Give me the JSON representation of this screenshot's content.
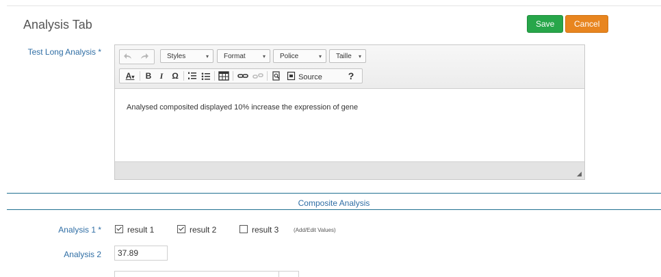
{
  "page": {
    "title": "Analysis Tab"
  },
  "actions": {
    "save_label": "Save",
    "cancel_label": "Cancel"
  },
  "fields": {
    "long_analysis": {
      "label": "Test Long Analysis *",
      "value": "Analysed composited displayed 10% increase the expression of gene"
    },
    "analysis_1": {
      "label": "Analysis 1 *",
      "options": [
        {
          "label": "result 1",
          "checked": true
        },
        {
          "label": "result 2",
          "checked": true
        },
        {
          "label": "result 3",
          "checked": false
        }
      ],
      "add_edit_link": "(Add/Edit Values)"
    },
    "analysis_2": {
      "label": "Analysis 2",
      "value": "37.89"
    }
  },
  "editor_toolbar": {
    "combos": {
      "styles": "Styles",
      "format": "Format",
      "police": "Police",
      "taille": "Taille"
    },
    "source_label": "Source",
    "icons": [
      "undo-icon",
      "redo-icon",
      "text-color-icon",
      "bold-icon",
      "italic-icon",
      "special-char-icon",
      "numbered-list-icon",
      "bulleted-list-icon",
      "table-icon",
      "link-icon",
      "unlink-icon",
      "preview-icon",
      "source-icon",
      "help-icon"
    ]
  },
  "section": {
    "title": "Composite Analysis"
  },
  "colors": {
    "label_blue": "#2e6da4",
    "save_green": "#27a64a",
    "cancel_orange": "#e8851f",
    "section_rule": "#1f6f8f"
  }
}
